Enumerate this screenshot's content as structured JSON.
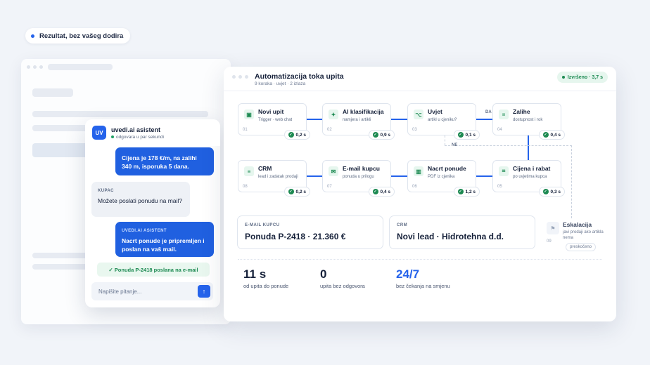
{
  "badge": {
    "label": "Rezultat, bez vašeg dodira"
  },
  "chat": {
    "avatar": "UV",
    "title": "uvedi.ai asistent",
    "subtitle": "odgovara u par sekundi",
    "messages": [
      {
        "role": "assistant",
        "text": "Cijena je 178 €/m, na zalihi 340 m, isporuka 5 dana."
      },
      {
        "role": "customer",
        "label": "KUPAC",
        "text": "Možete poslati ponudu na mail?"
      },
      {
        "role": "assistant",
        "label": "UVEDI.AI ASISTENT",
        "text": "Nacrt ponude je pripremljen i poslan na vaš mail."
      }
    ],
    "confirmation": "✓ Ponuda P-2418 poslana na e-mail",
    "input_placeholder": "Napišite pitanje...",
    "send_icon": "arrow-up-icon"
  },
  "workflow": {
    "title": "Automatizacija toka upita",
    "subtitle": "9 koraka · uvjet · 2 izlaza",
    "status": "Izvršeno · 3,7 s",
    "branch_yes": "DA",
    "branch_no": "NE",
    "nodes": [
      {
        "num": "01",
        "title": "Novi upit",
        "sub": "Trigger · web chat",
        "time": "0,2 s",
        "icon": "window-icon"
      },
      {
        "num": "02",
        "title": "AI klasifikacija",
        "sub": "namjera i artikli",
        "time": "0,9 s",
        "icon": "sparkle-icon"
      },
      {
        "num": "03",
        "title": "Uvjet",
        "sub": "artikl u cjeniku?",
        "time": "0,1 s",
        "icon": "branch-icon"
      },
      {
        "num": "04",
        "title": "Zalihe",
        "sub": "dostupnost i rok",
        "time": "0,4 s",
        "icon": "list-icon"
      },
      {
        "num": "05",
        "title": "Cijena i rabat",
        "sub": "po uvjetima kupca",
        "time": "0,3 s",
        "icon": "calculator-icon"
      },
      {
        "num": "06",
        "title": "Nacrt ponude",
        "sub": "PDF iz cjenika",
        "time": "1,2 s",
        "icon": "document-icon"
      },
      {
        "num": "07",
        "title": "E-mail kupcu",
        "sub": "ponuda u prilogu",
        "time": "0,4 s",
        "icon": "mail-icon"
      },
      {
        "num": "08",
        "title": "CRM",
        "sub": "lead i zadatak prodaji",
        "time": "0,2 s",
        "icon": "database-icon"
      }
    ],
    "escalation": {
      "num": "09",
      "title": "Eskalacija",
      "sub": "javi prodaji ako artikla nema",
      "status": "preskočeno",
      "icon": "flag-icon"
    },
    "outputs": [
      {
        "label": "E-MAIL KUPCU",
        "value": "Ponuda P-2418 · 21.360 €"
      },
      {
        "label": "CRM",
        "value": "Novi lead · Hidrotehna d.d."
      }
    ],
    "stats": [
      {
        "value": "11 s",
        "label": "od upita do ponude",
        "color": "#16213a"
      },
      {
        "value": "0",
        "label": "upita bez odgovora",
        "color": "#16213a"
      },
      {
        "value": "24/7",
        "label": "bez čekanja na smjenu",
        "color": "#2563eb"
      }
    ]
  }
}
